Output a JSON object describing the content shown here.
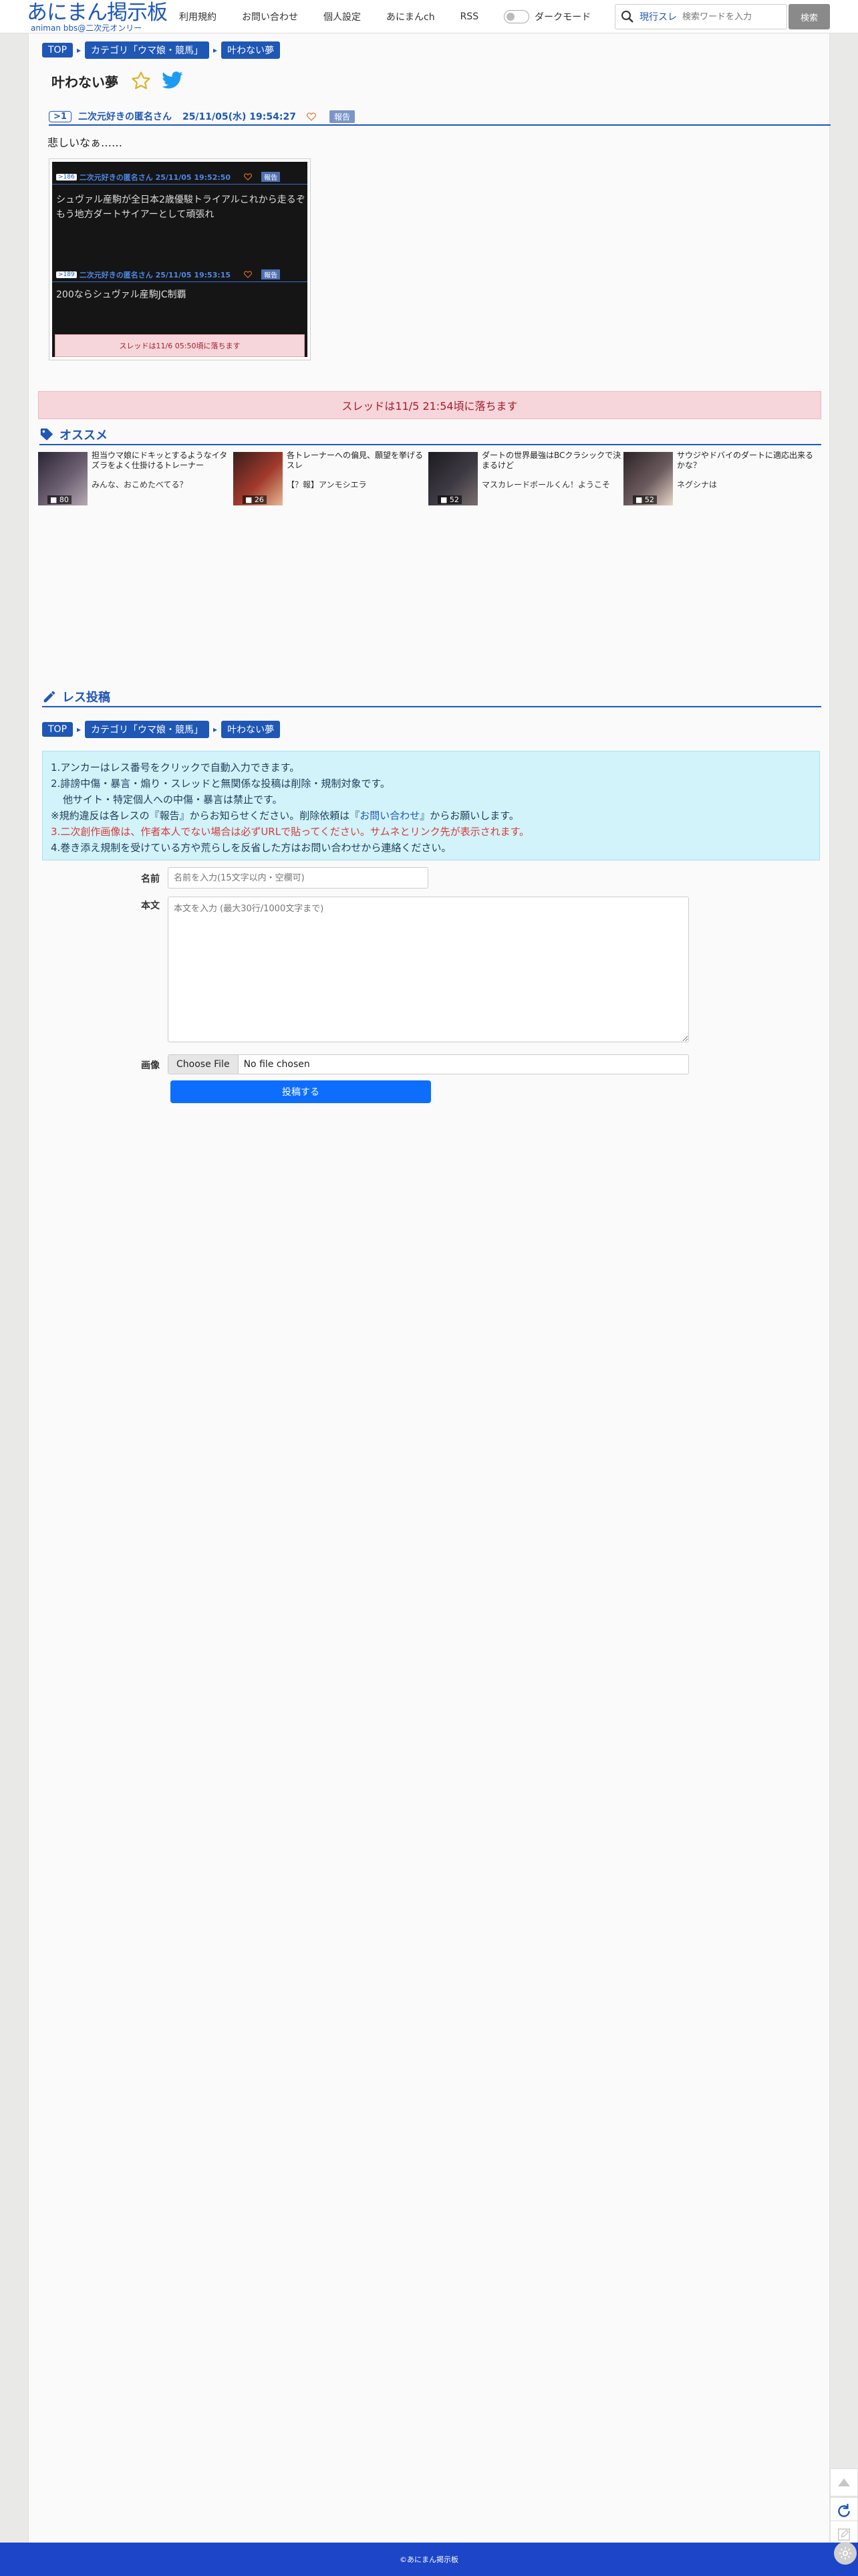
{
  "site": {
    "logo_main": "あにまん掲示板",
    "logo_sub": "animan bbs@二次元オンリー"
  },
  "nav": {
    "links": [
      "利用規約",
      "お問い合わせ",
      "個人設定",
      "あにまんch",
      "RSS"
    ],
    "dark_mode_label": "ダークモード"
  },
  "search": {
    "scope": "現行スレ",
    "placeholder": "検索ワードを入力",
    "button": "検索"
  },
  "breadcrumb": {
    "top": "TOP",
    "category": "カテゴリ「ウマ娘・競馬」",
    "thread": "叶わない夢"
  },
  "thread": {
    "title": "叶わない夢"
  },
  "post": {
    "res_num": ">1",
    "poster": "二次元好きの匿名さん",
    "date": "25/11/05(水) 19:54:27",
    "report": "報告",
    "body": "悲しいなぁ……"
  },
  "embed": {
    "post1": {
      "num": ">186",
      "header": "二次元好きの匿名さん 25/11/05 19:52:50",
      "report": "報告",
      "line1": "シュヴァル産駒が全日本2歳優駿トライアルこれから走るぞ",
      "line2": "もう地方ダートサイアーとして頑張れ"
    },
    "post2": {
      "num": ">189",
      "header": "二次元好きの匿名さん 25/11/05 19:53:15",
      "report": "報告",
      "line1": "200ならシュヴァル産駒JC制覇"
    },
    "expire": "スレッドは11/6 05:50頃に落ちます"
  },
  "expire_notice": "スレッドは11/5 21:54頃に落ちます",
  "recommend": {
    "title": "オススメ",
    "items": [
      {
        "title": "担当ウマ娘にドキッとするようなイタズラをよく仕掛けるトレーナー",
        "last": "みんな、おこめたべてる？",
        "count": "80"
      },
      {
        "title": "各トレーナーへの偏見、願望を挙げるスレ",
        "last": "【？報】アンモシエラ",
        "count": "26"
      },
      {
        "title": "ダートの世界最強はBCクラシックで決まるけど",
        "last": "マスカレードボールくん！ようこそ",
        "count": "52"
      },
      {
        "title": "サウジやドバイのダートに適応出来るかな？",
        "last": "ネグシナは",
        "count": "52"
      }
    ]
  },
  "post_form": {
    "title": "レス投稿",
    "notice": {
      "l1": "1.アンカーはレス番号をクリックで自動入力できます。",
      "l2": "2.誹謗中傷・暴言・煽り・スレッドと無関係な投稿は削除・規制対象です。",
      "l3": "他サイト・特定個人への中傷・暴言は禁止です。",
      "l4a": "※規約違反は各レスの『報告』からお知らせください。削除依頼は『",
      "l4link": "お問い合わせ",
      "l4b": "』からお願いします。",
      "l5a": "3.",
      "l5red": "二次創作画像は、作者本人でない場合は必ずURLで貼ってください。サムネとリンク先が表示されます。",
      "l6": "4.巻き添え規制を受けている方や荒らしを反省した方はお問い合わせから連絡ください。"
    },
    "name_label": "名前",
    "name_placeholder": "名前を入力(15文字以内・空欄可)",
    "body_label": "本文",
    "body_placeholder": "本文を入力 (最大30行/1000文字まで)",
    "image_label": "画像",
    "file_button": "Choose File",
    "file_none": "No file chosen",
    "submit": "投稿する"
  },
  "footer": "©あにまん掲示板",
  "colors": {
    "brand": "#1f57b5",
    "footer": "#1c45c8",
    "submit": "#0d6efd",
    "expire_bg": "#f6d6da"
  }
}
